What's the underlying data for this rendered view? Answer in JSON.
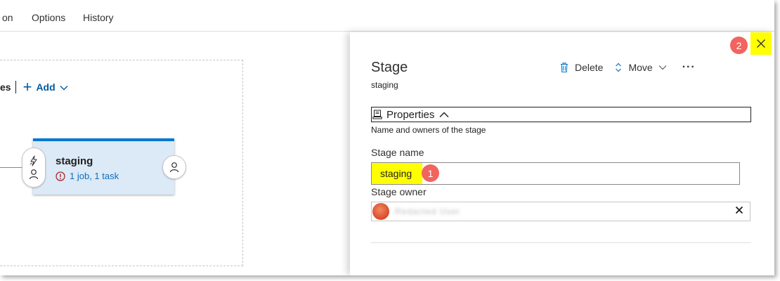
{
  "tabs": [
    {
      "label": "on"
    },
    {
      "label": "Options"
    },
    {
      "label": "History"
    }
  ],
  "canvas": {
    "partial_label": "es",
    "add_label": "Add",
    "stage": {
      "name": "staging",
      "status": "1 job, 1 task"
    }
  },
  "panel": {
    "title": "Stage",
    "subtitle": "staging",
    "toolbar": {
      "delete_label": "Delete",
      "move_label": "Move",
      "more_label": "···"
    },
    "section": {
      "title": "Properties",
      "description": "Name and owners of the stage"
    },
    "stage_name_label": "Stage name",
    "stage_name_value": "staging",
    "stage_owner_label": "Stage owner",
    "owner_name": "Redacted User"
  },
  "annotations": {
    "badge_1": "1",
    "badge_2": "2"
  },
  "colors": {
    "accent": "#0078d4",
    "link": "#106ebe",
    "error": "#a4262c",
    "highlight": "#ffff00",
    "badge": "#f1645f",
    "card_bg": "#dce9f6"
  }
}
